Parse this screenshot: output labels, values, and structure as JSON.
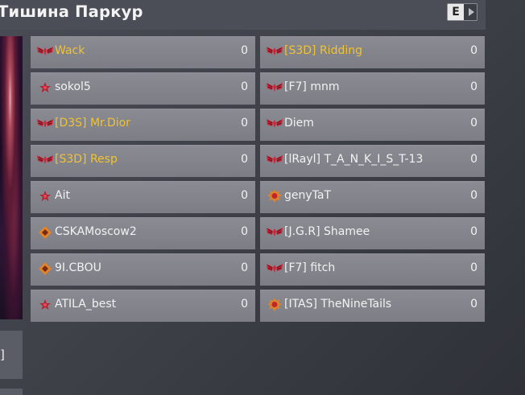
{
  "header": {
    "title": "Тишина Паркур",
    "lang_button": "E"
  },
  "left_panel": {
    "text": "]"
  },
  "teams": {
    "left": [
      {
        "name": "Wack",
        "score": "0",
        "rank": "rank-wings-icon",
        "highlight": true
      },
      {
        "name": "sokol5",
        "score": "0",
        "rank": "rank-star-icon",
        "highlight": false
      },
      {
        "name": "[D3S] Mr.Dior",
        "score": "0",
        "rank": "rank-wings-icon",
        "highlight": true
      },
      {
        "name": "[S3D] Resp",
        "score": "0",
        "rank": "rank-wings-icon",
        "highlight": true
      },
      {
        "name": "Ait",
        "score": "0",
        "rank": "rank-star-icon",
        "highlight": false
      },
      {
        "name": "CSKAMoscow2",
        "score": "0",
        "rank": "rank-diamond-icon",
        "highlight": false
      },
      {
        "name": "9I.CBOU",
        "score": "0",
        "rank": "rank-diamond-icon",
        "highlight": false
      },
      {
        "name": "ATILA_best",
        "score": "0",
        "rank": "rank-star-icon",
        "highlight": false
      }
    ],
    "right": [
      {
        "name": "[S3D] Ridding",
        "score": "0",
        "rank": "rank-wings-icon",
        "highlight": true
      },
      {
        "name": "[F7] mnm",
        "score": "0",
        "rank": "rank-wings-icon",
        "highlight": false
      },
      {
        "name": "Diem",
        "score": "0",
        "rank": "rank-wings-icon",
        "highlight": false
      },
      {
        "name": "[lRayl] T_A_N_K_I_S_T-13",
        "score": "0",
        "rank": "rank-wings-icon",
        "highlight": false
      },
      {
        "name": "genyTaT",
        "score": "0",
        "rank": "rank-sun-icon",
        "highlight": false
      },
      {
        "name": "[J.G.R] Shamee",
        "score": "0",
        "rank": "rank-wings-icon",
        "highlight": false
      },
      {
        "name": "[F7] fitch",
        "score": "0",
        "rank": "rank-wings-icon",
        "highlight": false
      },
      {
        "name": "[ITAS] TheNineTails",
        "score": "0",
        "rank": "rank-sun-icon",
        "highlight": false
      }
    ]
  },
  "colors": {
    "highlight_name": "#f1c232",
    "row_bg": "#82838b",
    "rank_red": "#c8283a"
  }
}
